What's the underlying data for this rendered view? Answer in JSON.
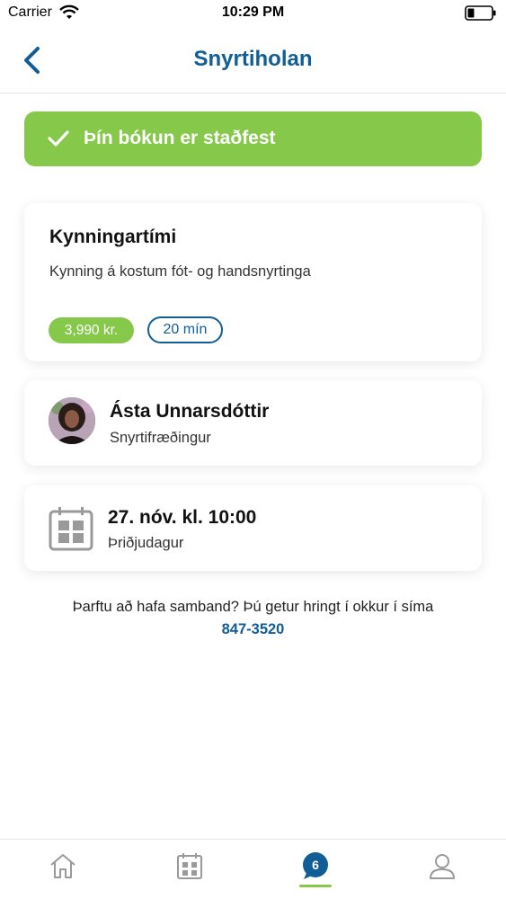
{
  "status_bar": {
    "carrier": "Carrier",
    "time": "10:29 PM"
  },
  "header": {
    "title": "Snyrtiholan"
  },
  "confirmation": {
    "message": "Þín bókun er staðfest"
  },
  "service": {
    "name": "Kynningartími",
    "description": "Kynning á kostum fót- og handsnyrtinga",
    "price": "3,990 kr.",
    "duration": "20 mín"
  },
  "staff": {
    "name": "Ásta Unnarsdóttir",
    "role": "Snyrtifræðingur"
  },
  "appointment": {
    "datetime": "27. nóv. kl. 10:00",
    "weekday": "Þriðjudagur"
  },
  "contact": {
    "text": "Þarftu að hafa samband? Þú getur hringt í okkur í síma",
    "phone": "847-3520"
  },
  "tab_bar": {
    "bookings_badge": "6",
    "active_tab": "bookings"
  },
  "colors": {
    "brand_blue": "#115d96",
    "success_green": "#86c84a",
    "icon_gray": "#9a9a9a"
  },
  "icons": [
    "wifi-icon",
    "battery-icon",
    "back-chevron-icon",
    "check-icon",
    "calendar-icon",
    "home-icon",
    "calendar-grid-icon",
    "chat-badge-icon",
    "user-icon"
  ]
}
